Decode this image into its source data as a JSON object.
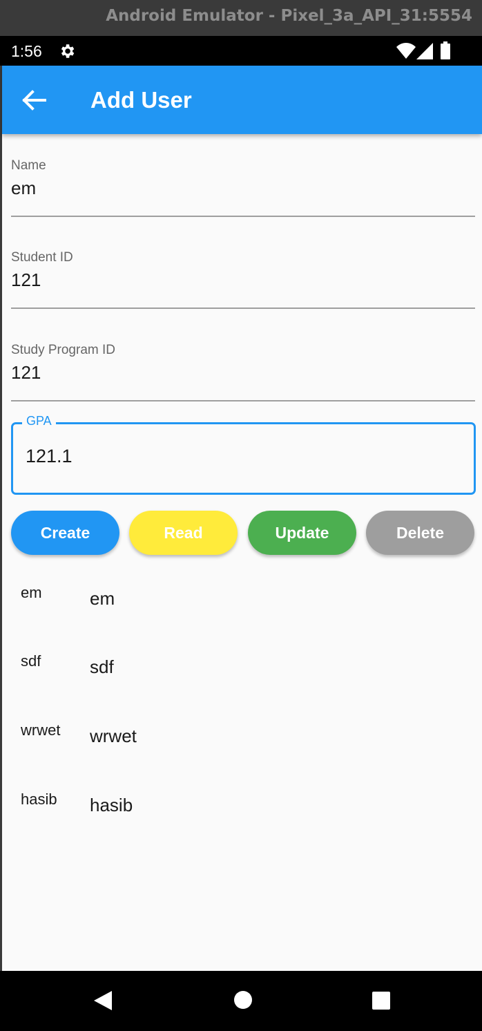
{
  "window": {
    "title": "Android Emulator - Pixel_3a_API_31:5554"
  },
  "status_bar": {
    "time": "1:56"
  },
  "app_bar": {
    "title": "Add User"
  },
  "form": {
    "name": {
      "label": "Name",
      "value": "em"
    },
    "student_id": {
      "label": "Student ID",
      "value": "121"
    },
    "study_program_id": {
      "label": "Study Program ID",
      "value": "121"
    },
    "gpa": {
      "label": "GPA",
      "value": "121.1"
    }
  },
  "buttons": {
    "create": {
      "label": "Create",
      "color": "#2196f3"
    },
    "read": {
      "label": "Read",
      "color": "#ffeb3b"
    },
    "update": {
      "label": "Update",
      "color": "#4caf50"
    },
    "delete": {
      "label": "Delete",
      "color": "#9e9e9e"
    }
  },
  "users": [
    {
      "col1": "em",
      "col2": "em"
    },
    {
      "col1": "sdf",
      "col2": "sdf"
    },
    {
      "col1": "wrwet",
      "col2": "wrwet"
    },
    {
      "col1": "hasib",
      "col2": "hasib"
    }
  ],
  "icons": {
    "back": "arrow-back-icon",
    "settings": "gear-icon",
    "wifi": "wifi-icon",
    "signal": "signal-icon",
    "battery": "battery-icon",
    "nav_back": "triangle-back-icon",
    "nav_home": "circle-home-icon",
    "nav_recents": "square-recents-icon"
  }
}
